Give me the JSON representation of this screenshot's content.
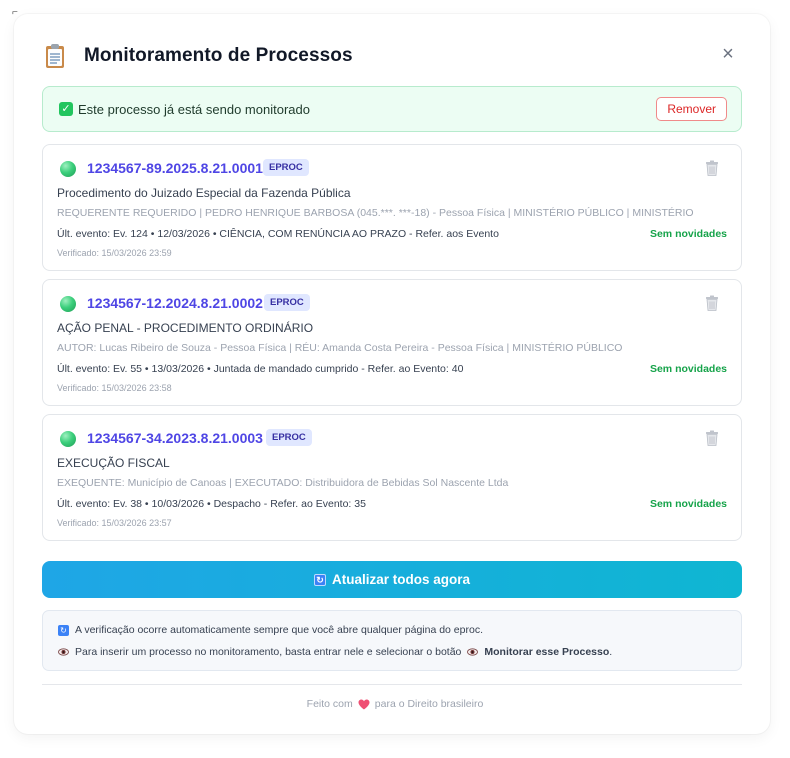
{
  "header": {
    "title": "Monitoramento de Processos",
    "close_label": "×"
  },
  "banner": {
    "text": "Este processo já está sendo monitorado",
    "remove_label": "Remover"
  },
  "processes": [
    {
      "number": "1234567-89.2025.8.21.0001",
      "system": "EPROC",
      "classe": "Procedimento do Juizado Especial da Fazenda Pública",
      "partes": "REQUERENTE REQUERIDO | PEDRO HENRIQUE BARBOSA (045.***. ***-18) - Pessoa Física | MINISTÉRIO PÚBLICO | MINISTÉRIO P...",
      "evento": "Últ. evento: Ev. 124 • 12/03/2026 • CIÊNCIA, COM RENÚNCIA AO PRAZO - Refer. aos Evento",
      "status": "Sem novidades",
      "verificado": "Verificado: 15/03/2026 23:59"
    },
    {
      "number": "1234567-12.2024.8.21.0002",
      "system": "EPROC",
      "classe": "AÇÃO PENAL - PROCEDIMENTO ORDINÁRIO",
      "partes": "AUTOR: Lucas Ribeiro de Souza - Pessoa Física | RÉU: Amanda Costa Pereira - Pessoa Física | MINISTÉRIO PÚBLICO",
      "evento": "Últ. evento: Ev. 55 • 13/03/2026 • Juntada de mandado cumprido - Refer. ao Evento: 40",
      "status": "Sem novidades",
      "verificado": "Verificado: 15/03/2026 23:58"
    },
    {
      "number": "1234567-34.2023.8.21.0003",
      "system": "EPROC",
      "classe": "EXECUÇÃO FISCAL",
      "partes": "EXEQUENTE: Município de Canoas | EXECUTADO: Distribuidora de Bebidas Sol Nascente Ltda",
      "evento": "Últ. evento: Ev. 38 • 10/03/2026 • Despacho - Refer. ao Evento: 35",
      "status": "Sem novidades",
      "verificado": "Verificado: 15/03/2026 23:57"
    }
  ],
  "update_button": {
    "label": "Atualizar todos agora"
  },
  "info": {
    "line1": "A verificação ocorre automaticamente sempre que você abre qualquer página do eproc.",
    "line2_prefix": "Para inserir um processo no monitoramento, basta entrar nele e selecionar o botão",
    "line2_button": "Monitorar esse Processo",
    "line2_suffix": "."
  },
  "footer": {
    "prefix": "Feito com",
    "suffix": "para o Direito brasileiro"
  },
  "colors": {
    "accent": "#4f46e5",
    "success": "#16a34a",
    "danger": "#dc2626",
    "button_gradient_start": "#1fa6e6",
    "button_gradient_end": "#0fb6d2"
  }
}
